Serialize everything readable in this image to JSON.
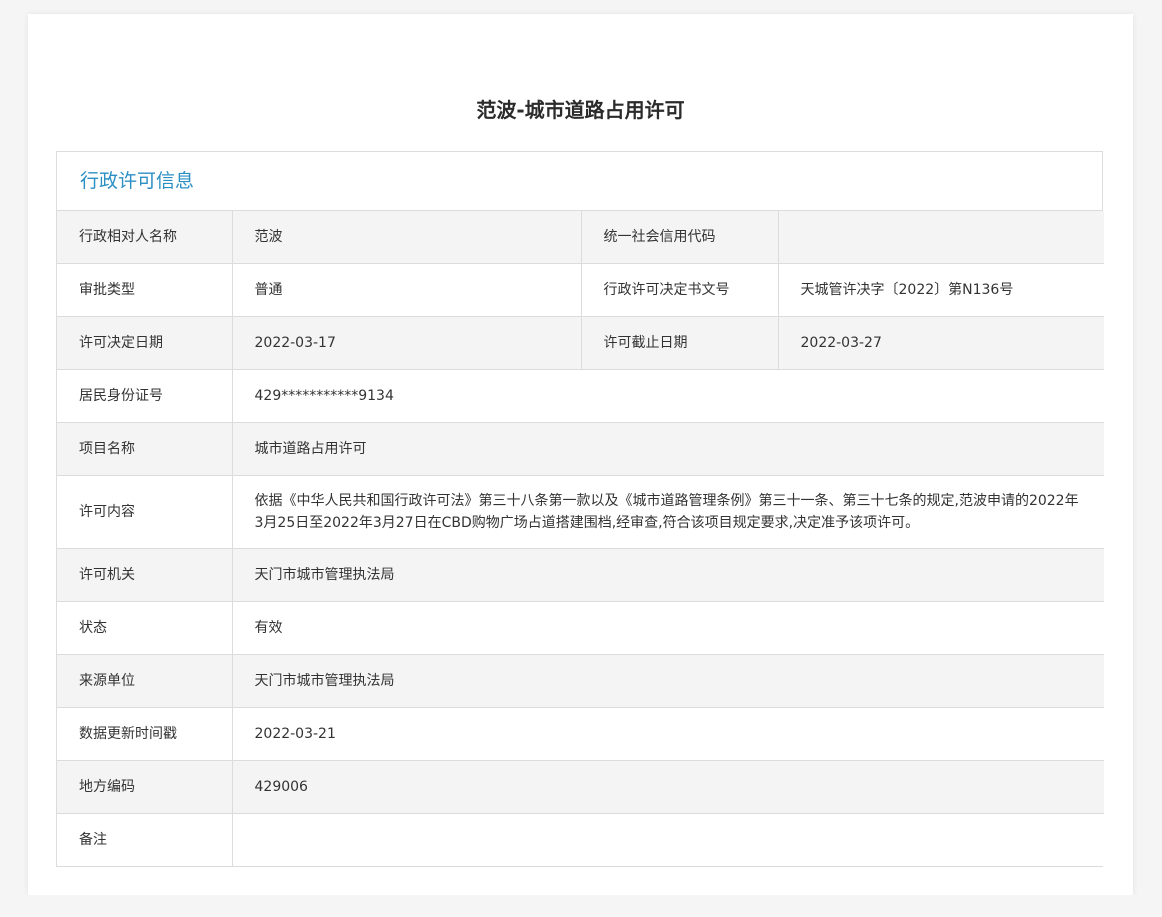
{
  "page": {
    "title": "范波-城市道路占用许可"
  },
  "panel": {
    "header": "行政许可信息"
  },
  "rows": {
    "r1": {
      "label1": "行政相对人名称",
      "value1": "范波",
      "label2": "统一社会信用代码",
      "value2": ""
    },
    "r2": {
      "label1": "审批类型",
      "value1": "普通",
      "label2": "行政许可决定书文号",
      "value2": "天城管许决字〔2022〕第N136号"
    },
    "r3": {
      "label1": "许可决定日期",
      "value1": "2022-03-17",
      "label2": "许可截止日期",
      "value2": "2022-03-27"
    },
    "r4": {
      "label": "居民身份证号",
      "value": "429***********9134"
    },
    "r5": {
      "label": "项目名称",
      "value": "城市道路占用许可"
    },
    "r6": {
      "label": "许可内容",
      "value": "依据《中华人民共和国行政许可法》第三十八条第一款以及《城市道路管理条例》第三十一条、第三十七条的规定,范波申请的2022年3月25日至2022年3月27日在CBD购物广场占道搭建围档,经审查,符合该项目规定要求,决定准予该项许可。"
    },
    "r7": {
      "label": "许可机关",
      "value": "天门市城市管理执法局"
    },
    "r8": {
      "label": "状态",
      "value": "有效"
    },
    "r9": {
      "label": "来源单位",
      "value": "天门市城市管理执法局"
    },
    "r10": {
      "label": "数据更新时间戳",
      "value": "2022-03-21"
    },
    "r11": {
      "label": "地方编码",
      "value": "429006"
    },
    "r12": {
      "label": "备注",
      "value": ""
    }
  },
  "colors": {
    "header_accent": "#2b8fc4",
    "row_alt_bg": "#f4f4f4",
    "border": "#dcdcdc"
  }
}
